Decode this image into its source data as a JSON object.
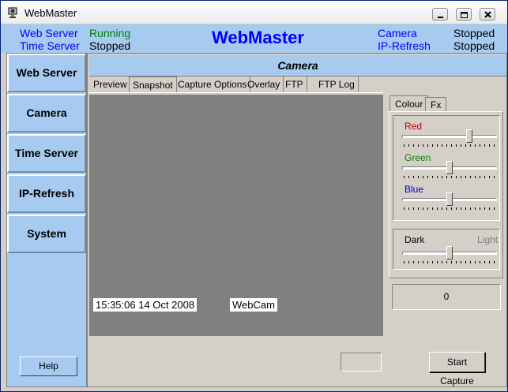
{
  "window": {
    "title": "WebMaster"
  },
  "status": {
    "web_server_label": "Web Server",
    "web_server_value": "Running",
    "time_server_label": "Time Server",
    "time_server_value": "Stopped",
    "camera_label": "Camera",
    "camera_value": "Stopped",
    "ip_refresh_label": "IP-Refresh",
    "ip_refresh_value": "Stopped",
    "app_title": "WebMaster"
  },
  "sidebar": {
    "items": [
      {
        "label": "Web Server"
      },
      {
        "label": "Camera"
      },
      {
        "label": "Time Server"
      },
      {
        "label": "IP-Refresh"
      },
      {
        "label": "System"
      }
    ],
    "help_label": "Help"
  },
  "main": {
    "section_title": "Camera",
    "tabs": [
      {
        "label": "Preview"
      },
      {
        "label": "Snapshot"
      },
      {
        "label": "Capture Options"
      },
      {
        "label": "Overlay"
      },
      {
        "label": "FTP"
      },
      {
        "label": "FTP Log"
      }
    ],
    "active_tab": "Snapshot",
    "overlay": {
      "timestamp": "15:35:06  14 Oct 2008",
      "caption": "WebCam"
    },
    "start_capture_label": "Start Capture"
  },
  "adjust": {
    "tabs": [
      {
        "label": "Colour"
      },
      {
        "label": "Fx"
      }
    ],
    "active_tab": "Colour",
    "red_label": "Red",
    "green_label": "Green",
    "blue_label": "Blue",
    "dark_label": "Dark",
    "light_label": "Light",
    "levels": {
      "red": 0.72,
      "green": 0.5,
      "blue": 0.5,
      "brightness": 0.5
    },
    "value": "0",
    "colors": {
      "red": "#c00000",
      "green": "#008000",
      "blue": "#0000c0",
      "light": "#808080"
    }
  }
}
